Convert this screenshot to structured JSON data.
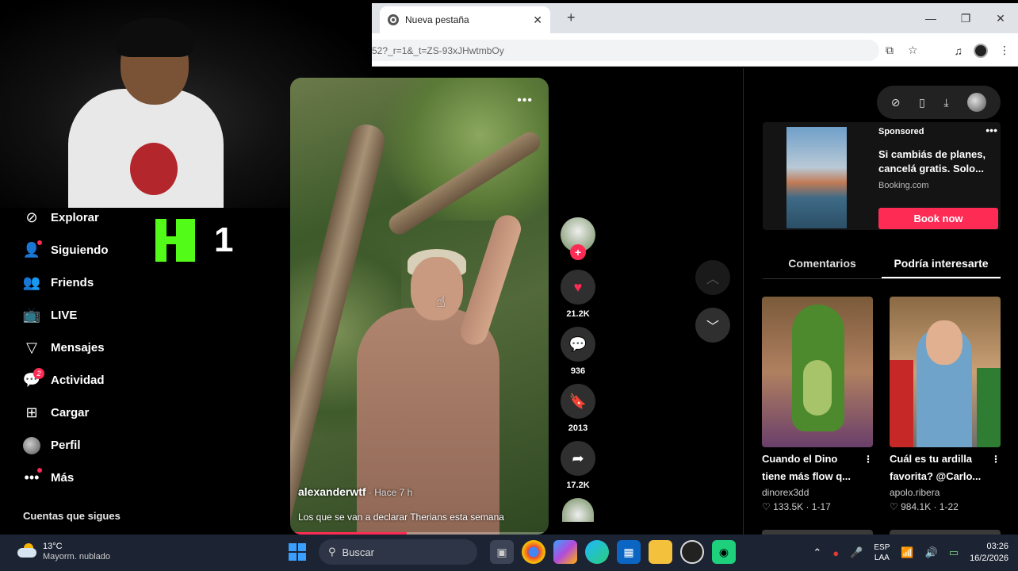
{
  "browser": {
    "tab_title": "Nueva pestaña",
    "url_partial": "52?_r=1&_t=ZS-93xJHwtmbOy"
  },
  "kick": {
    "count": "1"
  },
  "nav": {
    "items": [
      {
        "label": "Explorar"
      },
      {
        "label": "Siguiendo"
      },
      {
        "label": "Friends"
      },
      {
        "label": "LIVE"
      },
      {
        "label": "Mensajes"
      },
      {
        "label": "Actividad",
        "badge": "2"
      },
      {
        "label": "Cargar"
      },
      {
        "label": "Perfil"
      },
      {
        "label": "Más"
      }
    ],
    "following_heading": "Cuentas que sigues"
  },
  "video": {
    "author": "alexanderwtf",
    "time": " · Hace 7 h",
    "caption": "Los que se van a declarar Therians esta semana",
    "progress": 0.45,
    "more": "•••"
  },
  "actions": {
    "likes": "21.2K",
    "comments": "936",
    "saves": "2013",
    "shares": "17.2K"
  },
  "ad": {
    "sponsored": "Sponsored",
    "title": "Si cambiás de planes, cancelá gratis. Solo...",
    "domain": "Booking.com",
    "cta": "Book now"
  },
  "right_tabs": [
    {
      "label": "Comentarios",
      "active": false
    },
    {
      "label": "Podría interesarte",
      "active": true
    }
  ],
  "recommendations": [
    {
      "title": "Cuando el Dino tiene más flow q...",
      "user": "dinorex3dd",
      "stats": "♡ 133.5K · 1-17"
    },
    {
      "title": "Cuál es tu ardilla favorita? @Carlo...",
      "user": "apolo.ribera",
      "stats": "♡ 984.1K · 1-22"
    }
  ],
  "taskbar": {
    "temp": "13°C",
    "weather": "Mayorm. nublado",
    "search": "Buscar",
    "lang1": "ESP",
    "lang2": "LAA",
    "time": "03:26",
    "date": "16/2/2026"
  },
  "colors": {
    "accent": "#fe2c55",
    "kick": "#53fc18"
  }
}
